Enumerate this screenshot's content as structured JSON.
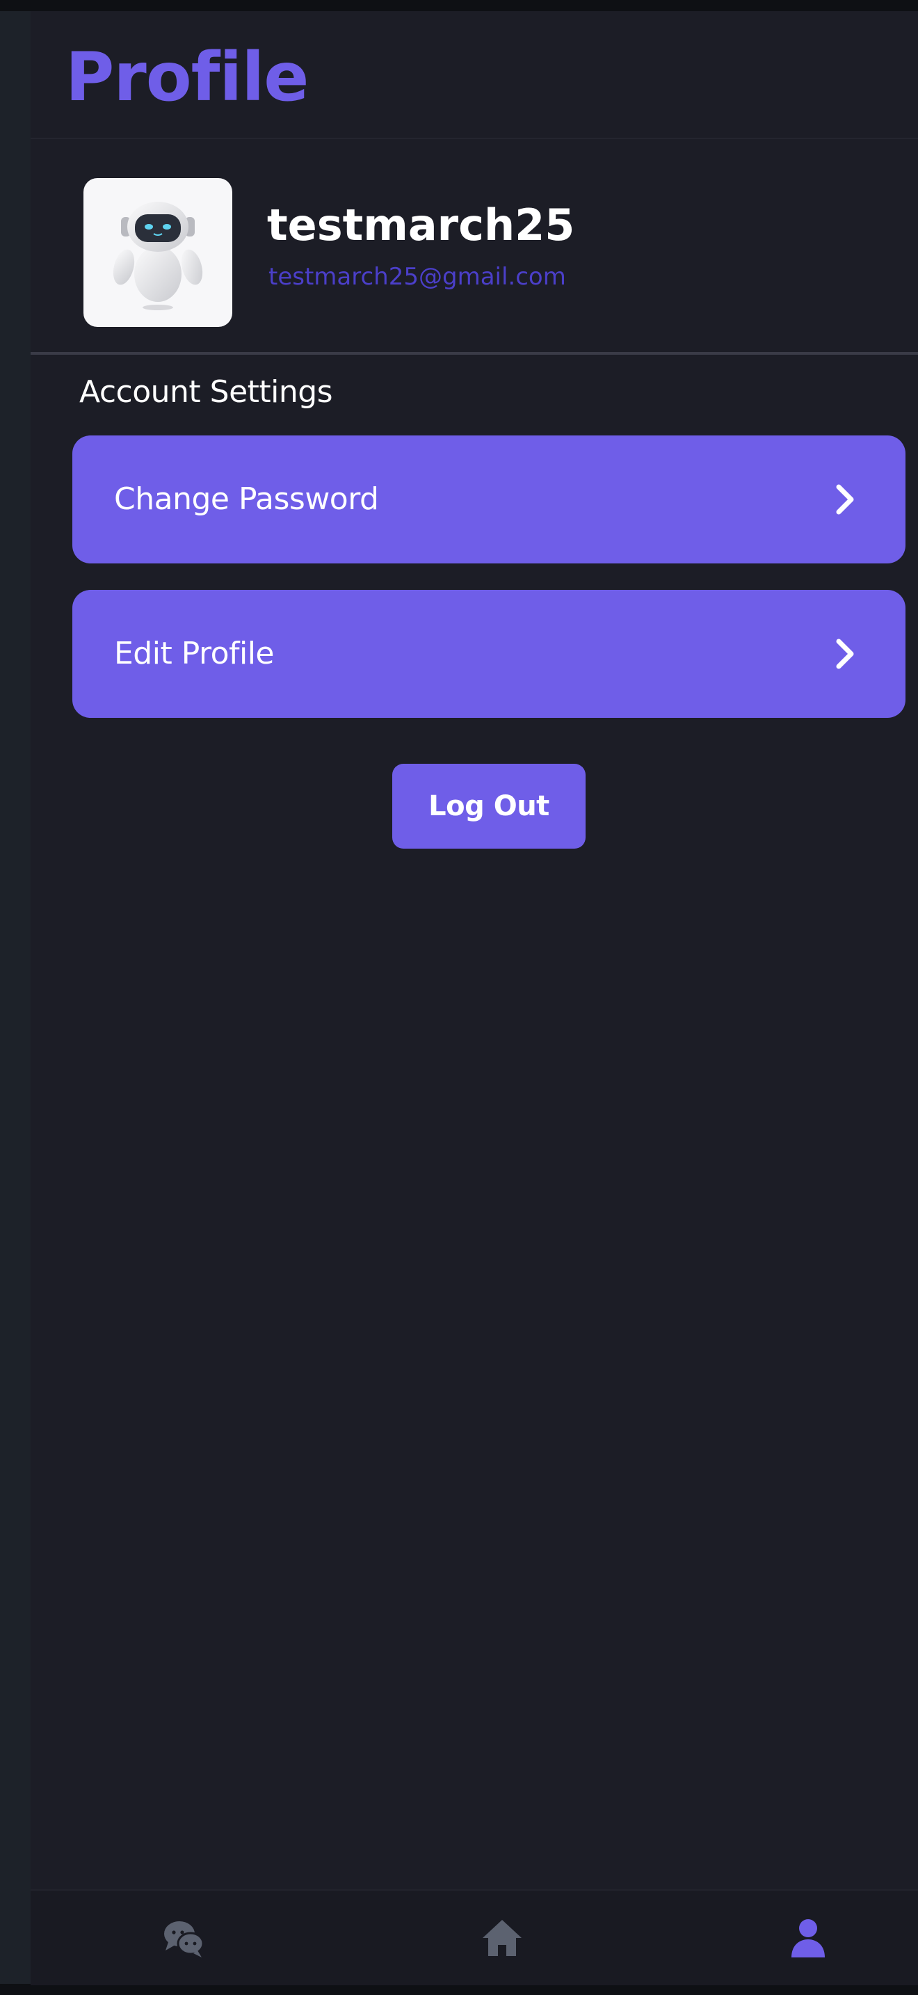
{
  "header": {
    "title": "Profile"
  },
  "user": {
    "username": "testmarch25",
    "email": "testmarch25@gmail.com",
    "avatar_icon": "robot-avatar-icon"
  },
  "account_settings": {
    "heading": "Account Settings",
    "items": [
      {
        "label": "Change Password",
        "icon": "chevron-right-icon"
      },
      {
        "label": "Edit Profile",
        "icon": "chevron-right-icon"
      }
    ]
  },
  "actions": {
    "logout_label": "Log Out"
  },
  "tabbar": {
    "tabs": [
      {
        "name": "chat",
        "icon": "chat-bubbles-icon",
        "active": false
      },
      {
        "name": "home",
        "icon": "home-icon",
        "active": false
      },
      {
        "name": "profile",
        "icon": "user-icon",
        "active": true
      }
    ]
  },
  "colors": {
    "accent": "#6f5ee8",
    "background": "#1c1d26",
    "email_text": "#4b3fc9",
    "inactive_icon": "#5c6270"
  }
}
